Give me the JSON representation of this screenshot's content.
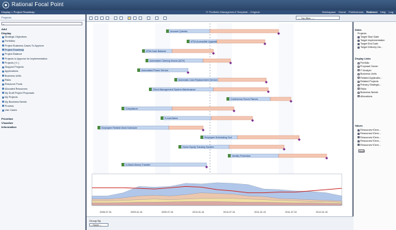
{
  "app": {
    "title": "Rational Focal Point",
    "crumb": "Display > Project Roadmap",
    "project": "IT Portfolio Management Template - Original",
    "links": [
      "Workspace",
      "Home",
      "Preferences",
      "Redirect",
      "Help",
      "Log"
    ],
    "active_link": "Redirect"
  },
  "sidebar": {
    "mini": "Projects",
    "add": "Add",
    "display": "Display",
    "items": [
      "Strategic Objectives",
      "Portfolios",
      "Project Business Cases To Approve",
      "Project Roadmap",
      "Project Balance",
      "Projects to Approve for Implementation",
      "Projects (+/-)",
      "Stopped Projects",
      "Applications",
      "Business Units",
      "Risks",
      "Resource Pools",
      "Allocated Resources",
      "My Draft Project Proposals",
      "My Projects",
      "My Business Needs",
      "Process",
      "Use Cases"
    ],
    "selected": "Project Roadmap",
    "bottom": [
      "Prioritize",
      "Visualize",
      "Information"
    ]
  },
  "toolbar": {
    "filter": "--- No filter ---"
  },
  "gantt": {
    "projects": [
      "Account Queries",
      "ATM-Accessible Upgrade",
      "ATM-Cash Balance",
      "Automated Clearing House (ACH)",
      "Automated Phone Service",
      "Automatic Card Replacement Service",
      "Client Management System Maintenance",
      "Conference Room Planner",
      "Compliance",
      "E-mail Alerts",
      "Employee Flexible Work Schedule",
      "Employee Scheduling Tool",
      "Home Equity Tracking System",
      "Identity Protection",
      "In-Bank Money Transfer"
    ],
    "dates": [
      "2008-07-01",
      "2009-01-01",
      "2009-07-01",
      "2010-01-01",
      "2010-07-01",
      "2011-01-01",
      "2011-07-01",
      "2012-01-01"
    ]
  },
  "chart_data": {
    "type": "area",
    "x": [
      "2008-07",
      "2008-10",
      "2009-01",
      "2009-04",
      "2009-07",
      "2009-10",
      "2010-01",
      "2010-04",
      "2010-07",
      "2010-10",
      "2011-01",
      "2011-04",
      "2011-07",
      "2011-10",
      "2012-01",
      "2012-04",
      "2012-07"
    ],
    "series": [
      {
        "values": [
          30,
          30,
          40,
          60,
          58,
          60,
          70,
          68,
          72,
          70,
          66,
          52,
          50,
          46,
          44,
          40,
          30
        ]
      },
      {
        "values": [
          20,
          20,
          24,
          30,
          32,
          30,
          34,
          40,
          38,
          36,
          30,
          28,
          22,
          20,
          18,
          16,
          14
        ]
      },
      {
        "values": [
          14,
          14,
          16,
          18,
          20,
          18,
          20,
          22,
          22,
          22,
          20,
          18,
          16,
          14,
          12,
          12,
          10
        ]
      },
      {
        "values": [
          8,
          8,
          9,
          10,
          10,
          11,
          12,
          12,
          12,
          11,
          10,
          10,
          9,
          8,
          8,
          7,
          6
        ]
      },
      {
        "values": [
          56,
          56,
          56,
          54,
          52,
          56,
          60,
          58,
          50,
          46,
          40,
          40,
          42,
          42,
          46,
          50,
          54
        ]
      }
    ],
    "colors": {
      "area1": "#a9c2e8",
      "area2": "#f2c7a8",
      "area3": "#f6e3a2",
      "area4": "#d9a3a3",
      "line": "#c9312f"
    }
  },
  "right": {
    "dates_head": "Dates",
    "projects_sub": "Projects",
    "dates": [
      "Target Start Date",
      "Target Implementation",
      "Target End Date",
      "Target Delivery Da..."
    ],
    "links_head": "Display Links",
    "links": [
      "Portfolio",
      "Proposal Owner",
      "IT Analyst",
      "Business Units",
      "Related Applicatio...",
      "Related Projects",
      "Primary Strategic...",
      "Risks",
      "Business Needs",
      "Allocations"
    ],
    "values_head": "Values",
    "values": [
      "Resources+Dem...",
      "Resources+Dem...",
      "Resources+Dem...",
      "Resources+Dem...",
      "Resources+Dem..."
    ],
    "apply": "Apply"
  },
  "groupby": {
    "label": "Group By",
    "value": "-- None --"
  }
}
